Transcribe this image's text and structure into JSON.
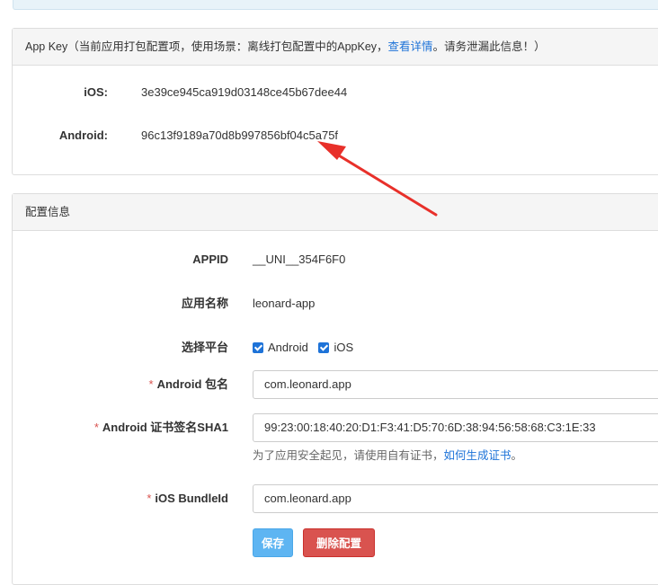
{
  "appkey_panel": {
    "heading_prefix": "App Key（当前应用打包配置项，使用场景：离线打包配置中的AppKey，",
    "heading_link": "查看详情",
    "heading_suffix": "。请务泄漏此信息！）",
    "ios_label": "iOS:",
    "ios_value": "3e39ce945ca919d03148ce45b67dee44",
    "android_label": "Android:",
    "android_value": "96c13f9189a70d8b997856bf04c5a75f"
  },
  "config_panel": {
    "heading": "配置信息",
    "appid_label": "APPID",
    "appid_value": "__UNI__354F6F0",
    "appname_label": "应用名称",
    "appname_value": "leonard-app",
    "platform_label": "选择平台",
    "platform_android": "Android",
    "platform_ios": "iOS",
    "required_mark": "*",
    "android_pkg_label": "Android 包名",
    "android_pkg_value": "com.leonard.app",
    "android_sha1_label": "Android 证书签名SHA1",
    "android_sha1_value": "99:23:00:18:40:20:D1:F3:41:D5:70:6D:38:94:56:58:68:C3:1E:33",
    "help_prefix": "为了应用安全起见，请使用自有证书，",
    "help_link": "如何生成证书",
    "help_suffix": "。",
    "ios_bundle_label": "iOS BundleId",
    "ios_bundle_value": "com.leonard.app",
    "save_button": "保存",
    "delete_button": "删除配置"
  },
  "colors": {
    "link": "#1e73d8",
    "required": "#d9534f",
    "save_button": "#5eb5f2",
    "delete_button": "#d9534f",
    "annotation_arrow": "#e8302a"
  },
  "icons": [
    "checkbox-checked-icon",
    "annotation-arrow"
  ]
}
